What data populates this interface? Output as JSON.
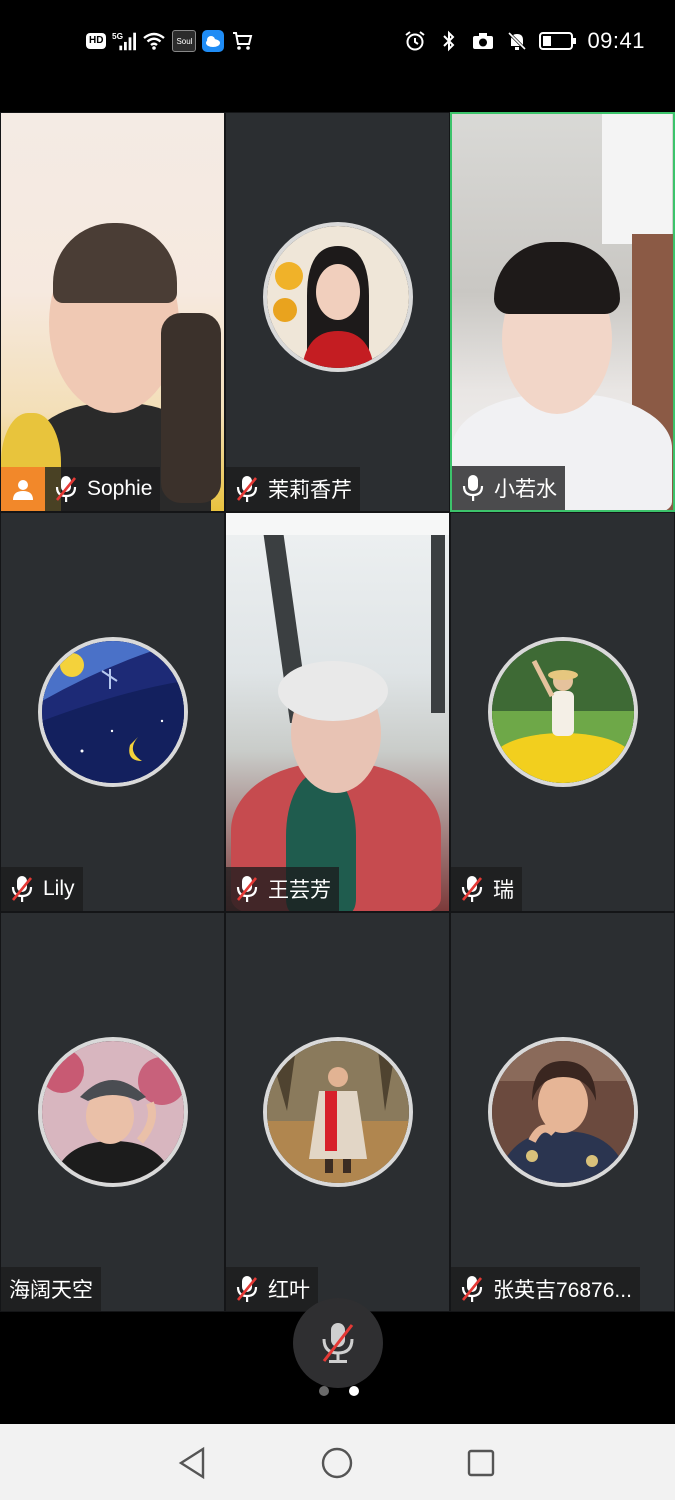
{
  "status_bar": {
    "hd": "HD",
    "network": "5G",
    "soul": "Soul",
    "time": "09:41"
  },
  "participants": [
    {
      "name": "Sophie",
      "mic": "muted",
      "video": true,
      "host": true
    },
    {
      "name": "茉莉香芹",
      "mic": "muted",
      "video": false
    },
    {
      "name": "小若水",
      "mic": "on",
      "video": true,
      "speaking": true
    },
    {
      "name": "Lily",
      "mic": "muted",
      "video": false
    },
    {
      "name": "王芸芳",
      "mic": "muted",
      "video": true
    },
    {
      "name": "瑞",
      "mic": "muted",
      "video": false
    },
    {
      "name": "海阔天空",
      "mic": "none",
      "video": false
    },
    {
      "name": "红叶",
      "mic": "muted",
      "video": false
    },
    {
      "name": "张英吉76876...",
      "mic": "muted",
      "video": false
    }
  ],
  "controls": {
    "mute_icon": "mic-muted-icon",
    "page_count": 2,
    "current_page": 2
  },
  "colors": {
    "tile_bg": "#2b2e31",
    "active_speaker_border": "#3cc36b",
    "host_badge": "#f2882a",
    "muted_red": "#e53935"
  }
}
